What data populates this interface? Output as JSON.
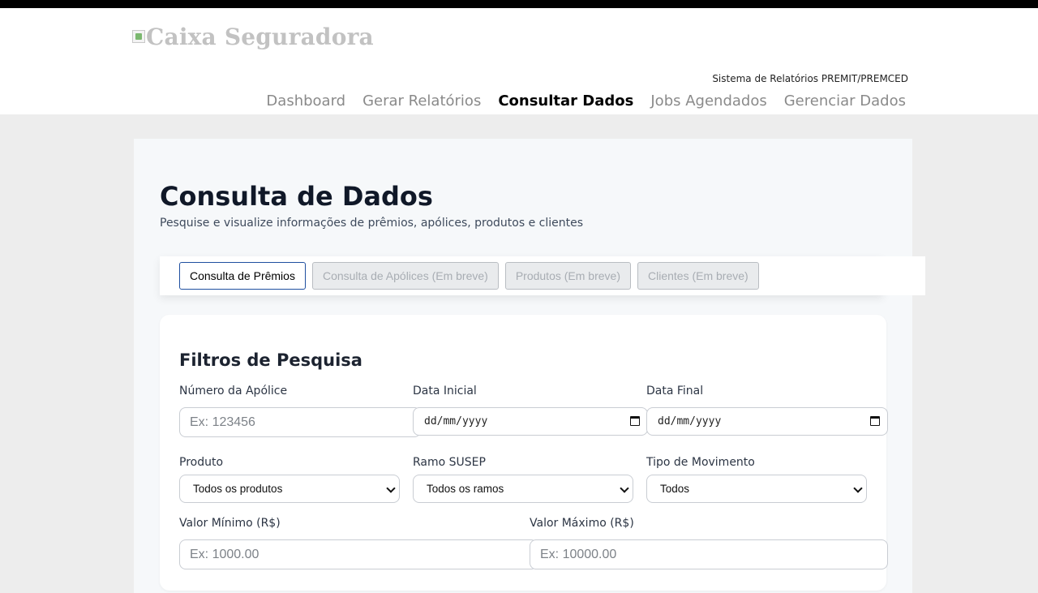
{
  "header": {
    "logo_text": "Caixa Seguradora",
    "system_label": "Sistema de Relatórios PREMIT/PREMCED",
    "nav": [
      {
        "label": "Dashboard"
      },
      {
        "label": "Gerar Relatórios"
      },
      {
        "label": "Consultar Dados",
        "active": true
      },
      {
        "label": "Jobs Agendados"
      },
      {
        "label": "Gerenciar Dados"
      }
    ]
  },
  "main": {
    "title": "Consulta de Dados",
    "subtitle": "Pesquise e visualize informações de prêmios, apólices, produtos e clientes",
    "tabs": [
      {
        "label": "Consulta de Prêmios",
        "active": true
      },
      {
        "label": "Consulta de Apólices (Em breve)",
        "disabled": true
      },
      {
        "label": "Produtos (Em breve)",
        "disabled": true
      },
      {
        "label": "Clientes (Em breve)",
        "disabled": true
      }
    ]
  },
  "filters": {
    "title": "Filtros de Pesquisa",
    "policy_number": {
      "label": "Número da Apólice",
      "placeholder": "Ex: 123456"
    },
    "start_date": {
      "label": "Data Inicial",
      "value": "dd/mm/yyyy"
    },
    "end_date": {
      "label": "Data Final",
      "value": "dd/mm/yyyy"
    },
    "product": {
      "label": "Produto",
      "value": "Todos os produtos"
    },
    "susep_branch": {
      "label": "Ramo SUSEP",
      "value": "Todos os ramos"
    },
    "movement_type": {
      "label": "Tipo de Movimento",
      "value": "Todos"
    },
    "min_value": {
      "label": "Valor Mínimo (R$)",
      "placeholder": "Ex: 1000.00"
    },
    "max_value": {
      "label": "Valor Máximo (R$)",
      "placeholder": "Ex: 10000.00"
    }
  }
}
